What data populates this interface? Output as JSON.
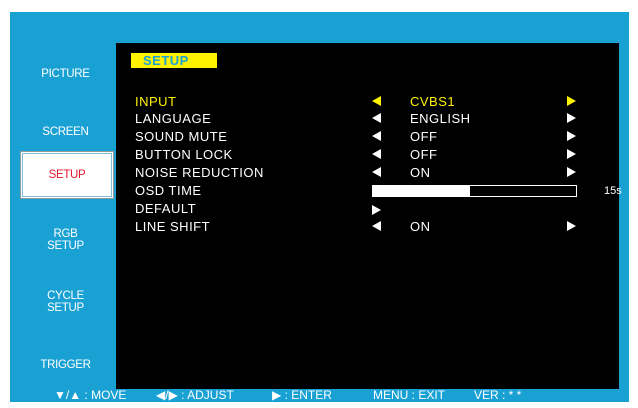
{
  "sidebar": {
    "tabs": [
      {
        "label": "PICTURE",
        "active": false
      },
      {
        "label": "SCREEN",
        "active": false
      },
      {
        "label": "SETUP",
        "active": true
      },
      {
        "label": "RGB\nSETUP",
        "active": false
      },
      {
        "label": "CYCLE\nSETUP",
        "active": false
      },
      {
        "label": "TRIGGER",
        "active": false
      }
    ]
  },
  "panel": {
    "title": "SETUP",
    "items": [
      {
        "label": "INPUT",
        "value": "CVBS1"
      },
      {
        "label": "LANGUAGE",
        "value": "ENGLISH"
      },
      {
        "label": "SOUND MUTE",
        "value": "OFF"
      },
      {
        "label": "BUTTON LOCK",
        "value": "OFF"
      },
      {
        "label": "NOISE REDUCTION",
        "value": "ON"
      },
      {
        "label": "OSD TIME",
        "value": ""
      },
      {
        "label": "DEFAULT",
        "value": ""
      },
      {
        "label": "LINE SHIFT",
        "value": "ON"
      }
    ],
    "osd_time": {
      "value_label": "15s",
      "fill_fraction": 0.48
    }
  },
  "footer": {
    "move": "▼/▲ : MOVE",
    "adjust": "◀/▶ : ADJUST",
    "enter": "▶ : ENTER",
    "exit": "MENU : EXIT",
    "version": "VER : * *"
  },
  "colors": {
    "frame": "#1aa1d4",
    "highlight": "#fff200",
    "active_tab_text": "#e3182d"
  }
}
